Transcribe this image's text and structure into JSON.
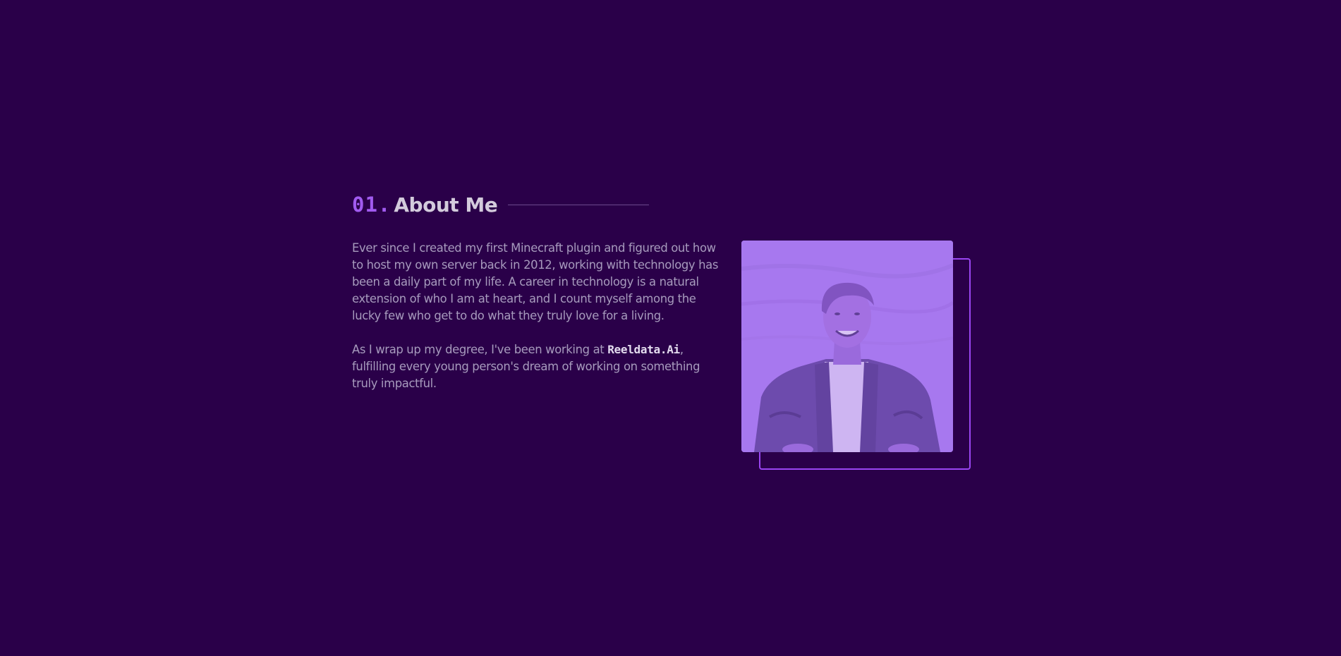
{
  "about": {
    "number": "01.",
    "title": "About Me",
    "paragraph1": "Ever since I created my first Minecraft plugin and figured out how to host my own server back in 2012, working with technology has been a daily part of my life. A career in technology is a natural extension of who I am at heart, and I count myself among the lucky few who get to do what they truly love for a living.",
    "paragraph2_before": "As I wrap up my degree, I've been working at ",
    "company": "Reeldata.Ai",
    "paragraph2_after": ", fulfilling every young person's dream of working on something truly impactful."
  },
  "colors": {
    "background": "#2a0049",
    "accent": "#a15bf0",
    "heading": "#d3cbdc",
    "body_text": "#a79bbd",
    "photo_tint": "#aa80ef"
  }
}
